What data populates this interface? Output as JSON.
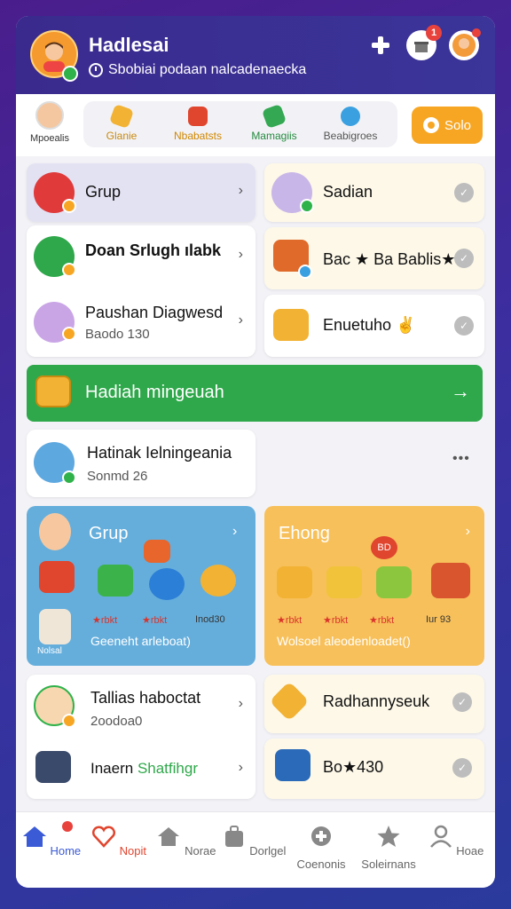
{
  "header": {
    "title": "Hadlesai",
    "subtitle": "Sbobiai podaan nalcadenaecka",
    "notif_count": "1"
  },
  "categories": {
    "first": "Mpoealis",
    "items": [
      "Glanie",
      "Nbabatsts",
      "Mamagiis",
      "Beabigroes"
    ],
    "solo_label": "Solo"
  },
  "cards": {
    "grup": "Grup",
    "sadian": "Sadian",
    "doan": "Doan Srlugh ılabk",
    "bac": "Bac ★ Ba Bablis★",
    "paushan_title": "Paushan Diagwesd",
    "paushan_sub": "Baodo 130",
    "enuetuho": "Enuetuho ✌",
    "banner": "Hadiah mingeuah",
    "hatinak_title": "Hatinak Ielningeania",
    "hatinak_sub": "Sonmd 26",
    "more": "•••",
    "blue_title": "Grup",
    "blue_stars": [
      "★rbkt",
      "★rbkt",
      "Inod30"
    ],
    "blue_mini": "Nolsal",
    "blue_note": "Geeneht arleboat)",
    "orange_title": "Ehong",
    "orange_badge": "BD",
    "orange_stars": [
      "★rbkt",
      "★rbkt",
      "★rbkt",
      "Iur 93"
    ],
    "orange_note": "Wolsoel aleodenloadet()",
    "tallias_title": "Tallias haboctat",
    "tallias_sub": "2oodoa0",
    "radhan": "Radhannyseuk",
    "inaern_a": "Inaern ",
    "inaern_b": "Shatfihgr",
    "bo": "Bo★430"
  },
  "nav": [
    "Home",
    "Nopit",
    "Norae",
    "Dorlgel",
    "Coenonis",
    "Soleirnans",
    "Hoae"
  ],
  "colors": {
    "accent_green": "#2ea84a",
    "accent_orange": "#f6a623",
    "header": "#3a2a8e",
    "nav_active": "#3b5bd6"
  }
}
